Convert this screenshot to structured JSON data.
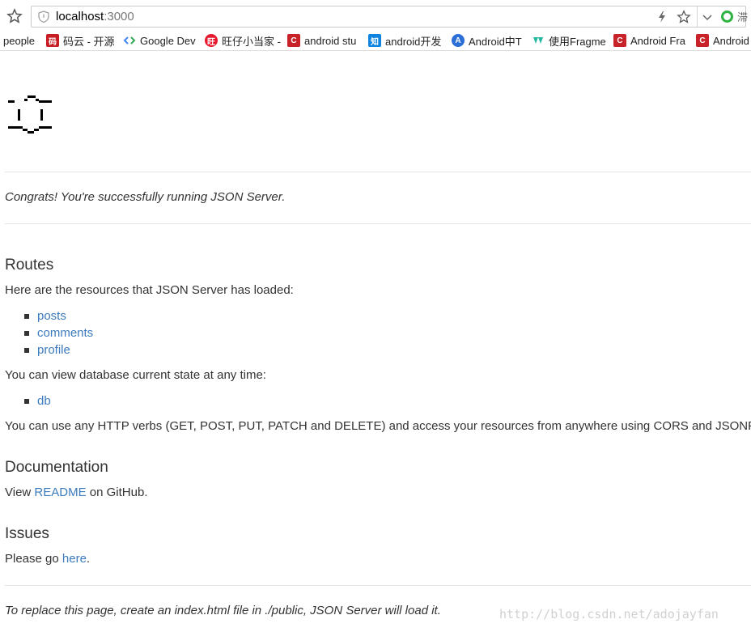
{
  "browser": {
    "url_host": "localhost",
    "url_port": ":3000",
    "search_text": "滞",
    "bookmarks": [
      {
        "label": "people",
        "icon": "none"
      },
      {
        "label": "码云 - 开源",
        "icon": "gitee-icon"
      },
      {
        "label": "Google Dev",
        "icon": "google-dev-icon"
      },
      {
        "label": "旺仔小当家 -",
        "icon": "weibo-icon"
      },
      {
        "label": "android stu",
        "icon": "csdn-icon"
      },
      {
        "label": "android开发",
        "icon": "zhihu-icon"
      },
      {
        "label": "Android中T",
        "icon": "blue-circle-icon"
      },
      {
        "label": "使用Fragme",
        "icon": "green-leaf-icon"
      },
      {
        "label": "Android Fra",
        "icon": "csdn-icon"
      },
      {
        "label": "Android",
        "icon": "csdn-icon"
      }
    ]
  },
  "page": {
    "congrats": "Congrats! You're successfully running JSON Server.",
    "routes_heading": "Routes",
    "routes_intro": "Here are the resources that JSON Server has loaded:",
    "resources": [
      "posts",
      "comments",
      "profile"
    ],
    "db_intro": "You can view database current state at any time:",
    "db_link": "db",
    "verbs_text": "You can use any HTTP verbs (GET, POST, PUT, PATCH and DELETE) and access your resources from anywhere using CORS and JSONP.",
    "docs_heading": "Documentation",
    "docs_prefix": "View ",
    "docs_link": "README",
    "docs_suffix": " on GitHub.",
    "issues_heading": "Issues",
    "issues_prefix": "Please go ",
    "issues_link": "here",
    "issues_suffix": ".",
    "footer": "To replace this page, create an index.html file in ./public, JSON Server will load it."
  },
  "watermark": "http://blog.csdn.net/adojayfan",
  "colors": {
    "link": "#3c7bbd",
    "text": "#333333"
  }
}
